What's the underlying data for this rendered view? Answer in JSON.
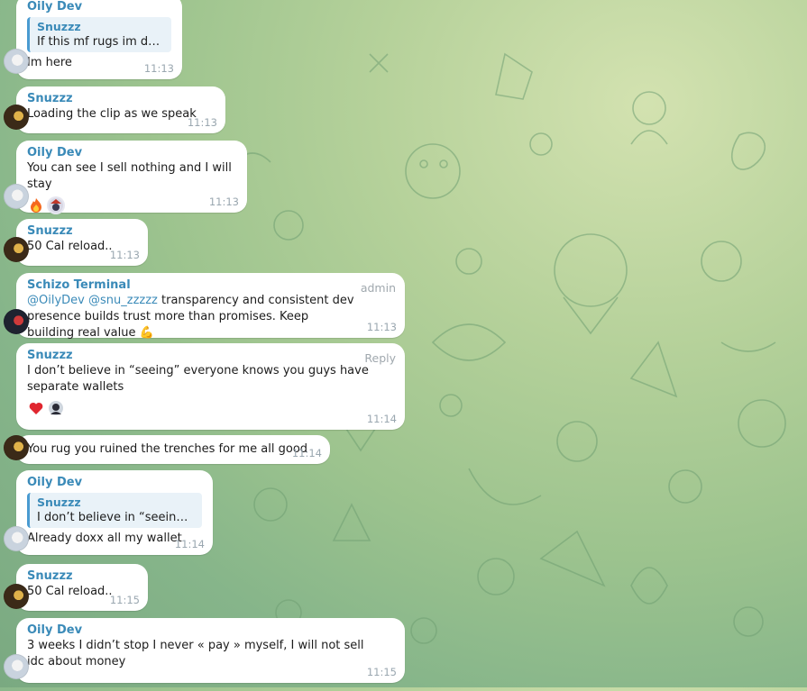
{
  "messages": [
    {
      "sender": "Oily Dev",
      "quote": {
        "name": "Snuzzz",
        "text": "If this mf rugs im done..."
      },
      "text": "Im here",
      "time": "11:13"
    },
    {
      "sender": "Snuzzz",
      "text": "Loading the clip as we speak",
      "time": "11:13"
    },
    {
      "sender": "Oily Dev",
      "text": "You can see I sell nothing and I will stay",
      "time": "11:13",
      "reactions": [
        "fire-emoji",
        "avatar-emoji"
      ]
    },
    {
      "sender": "Snuzzz",
      "text": "50 Cal reload..",
      "time": "11:13"
    },
    {
      "sender": "Schizo Terminal",
      "tag": "admin",
      "mentions": [
        "@OilyDev",
        "@snu_zzzzz"
      ],
      "text": "transparency and consistent dev presence builds trust more than promises. Keep building real value",
      "emoji": "💪",
      "time": "11:13"
    },
    {
      "sender": "Snuzzz",
      "tag": "Reply",
      "text": "I don’t believe in “seeing” everyone knows you guys have separate wallets",
      "time": "11:14",
      "reactions": [
        "heart-emoji",
        "avatar-emoji"
      ]
    },
    {
      "text": "You rug you ruined the trenches for me all good",
      "time": "11:14"
    },
    {
      "sender": "Oily Dev",
      "quote": {
        "name": "Snuzzz",
        "text": "I don’t believe in “seeing” ev..."
      },
      "text": "Already doxx all my wallet",
      "time": "11:14"
    },
    {
      "sender": "Snuzzz",
      "text": "50 Cal reload..",
      "time": "11:15"
    },
    {
      "sender": "Oily Dev",
      "text": "3 weeks I didn’t stop I never « pay » myself, I will not sell idc about money",
      "time": "11:15"
    }
  ]
}
